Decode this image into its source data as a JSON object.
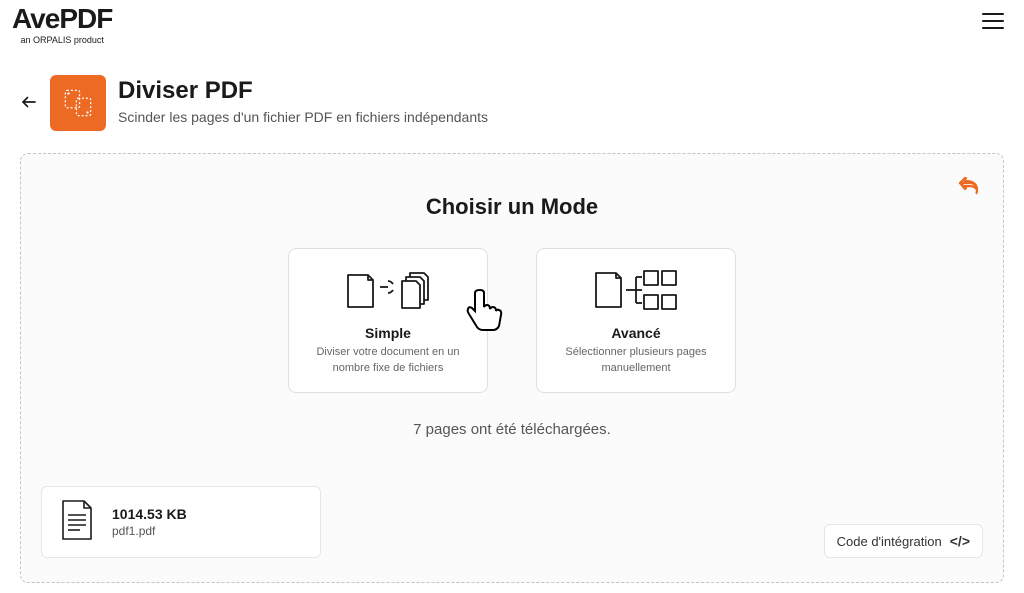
{
  "brand": {
    "name": "AvePDF",
    "tagline": "an ORPALIS product"
  },
  "page": {
    "title": "Diviser PDF",
    "subtitle": "Scinder les pages d'un fichier PDF en fichiers indépendants"
  },
  "panel": {
    "mode_heading": "Choisir un Mode",
    "status": "7 pages ont été téléchargées."
  },
  "modes": {
    "simple": {
      "title": "Simple",
      "desc": "Diviser votre document en un nombre fixe de fichiers"
    },
    "advanced": {
      "title": "Avancé",
      "desc": "Sélectionner plusieurs pages manuellement"
    }
  },
  "file": {
    "size": "1014.53 KB",
    "name": "pdf1.pdf"
  },
  "embed": {
    "label": "Code d'intégration",
    "icon": "</>"
  },
  "colors": {
    "accent": "#ec6a24"
  }
}
